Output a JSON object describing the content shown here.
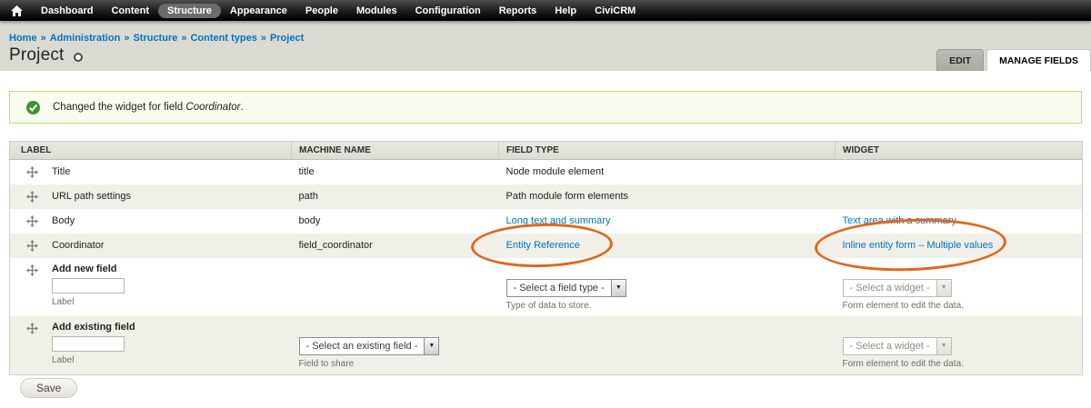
{
  "colors": {
    "link_blue": "#0074bd",
    "annotation_orange": "#e2661a",
    "success_green": "#3f8f34",
    "toolbar_black": "#111111",
    "header_band_gray": "#dbdad2"
  },
  "toolbar": {
    "items": [
      {
        "label": "Dashboard",
        "active": false
      },
      {
        "label": "Content",
        "active": false
      },
      {
        "label": "Structure",
        "active": true
      },
      {
        "label": "Appearance",
        "active": false
      },
      {
        "label": "People",
        "active": false
      },
      {
        "label": "Modules",
        "active": false
      },
      {
        "label": "Configuration",
        "active": false
      },
      {
        "label": "Reports",
        "active": false
      },
      {
        "label": "Help",
        "active": false
      },
      {
        "label": "CiviCRM",
        "active": false
      }
    ]
  },
  "breadcrumb": {
    "separator": "»",
    "items": [
      "Home",
      "Administration",
      "Structure",
      "Content types",
      "Project"
    ]
  },
  "page": {
    "title": "Project"
  },
  "tabs": {
    "edit": "EDIT",
    "manage_fields": "MANAGE FIELDS"
  },
  "status_message": {
    "prefix": "Changed the widget for field ",
    "emphasis": "Coordinator",
    "suffix": "."
  },
  "fields_table": {
    "headers": {
      "label": "LABEL",
      "machine_name": "MACHINE NAME",
      "field_type": "FIELD TYPE",
      "widget": "WIDGET"
    },
    "rows": [
      {
        "label": "Title",
        "machine_name": "title",
        "field_type": "Node module element",
        "widget": ""
      },
      {
        "label": "URL path settings",
        "machine_name": "path",
        "field_type": "Path module form elements",
        "widget": ""
      },
      {
        "label": "Body",
        "machine_name": "body",
        "field_type": "Long text and summary",
        "widget": "Text area with a summary"
      },
      {
        "label": "Coordinator",
        "machine_name": "field_coordinator",
        "field_type": "Entity Reference",
        "widget": "Inline entity form – Multiple values"
      }
    ],
    "add_new_field": {
      "title": "Add new field",
      "label_caption": "Label",
      "field_type_select": "- Select a field type -",
      "field_type_caption": "Type of data to store.",
      "widget_select": "- Select a widget -",
      "widget_caption": "Form element to edit the data."
    },
    "add_existing_field": {
      "title": "Add existing field",
      "label_caption": "Label",
      "existing_select": "- Select an existing field -",
      "existing_caption": "Field to share",
      "widget_select": "- Select a widget -",
      "widget_caption": "Form element to edit the data."
    }
  },
  "save_button": {
    "label": "Save"
  }
}
